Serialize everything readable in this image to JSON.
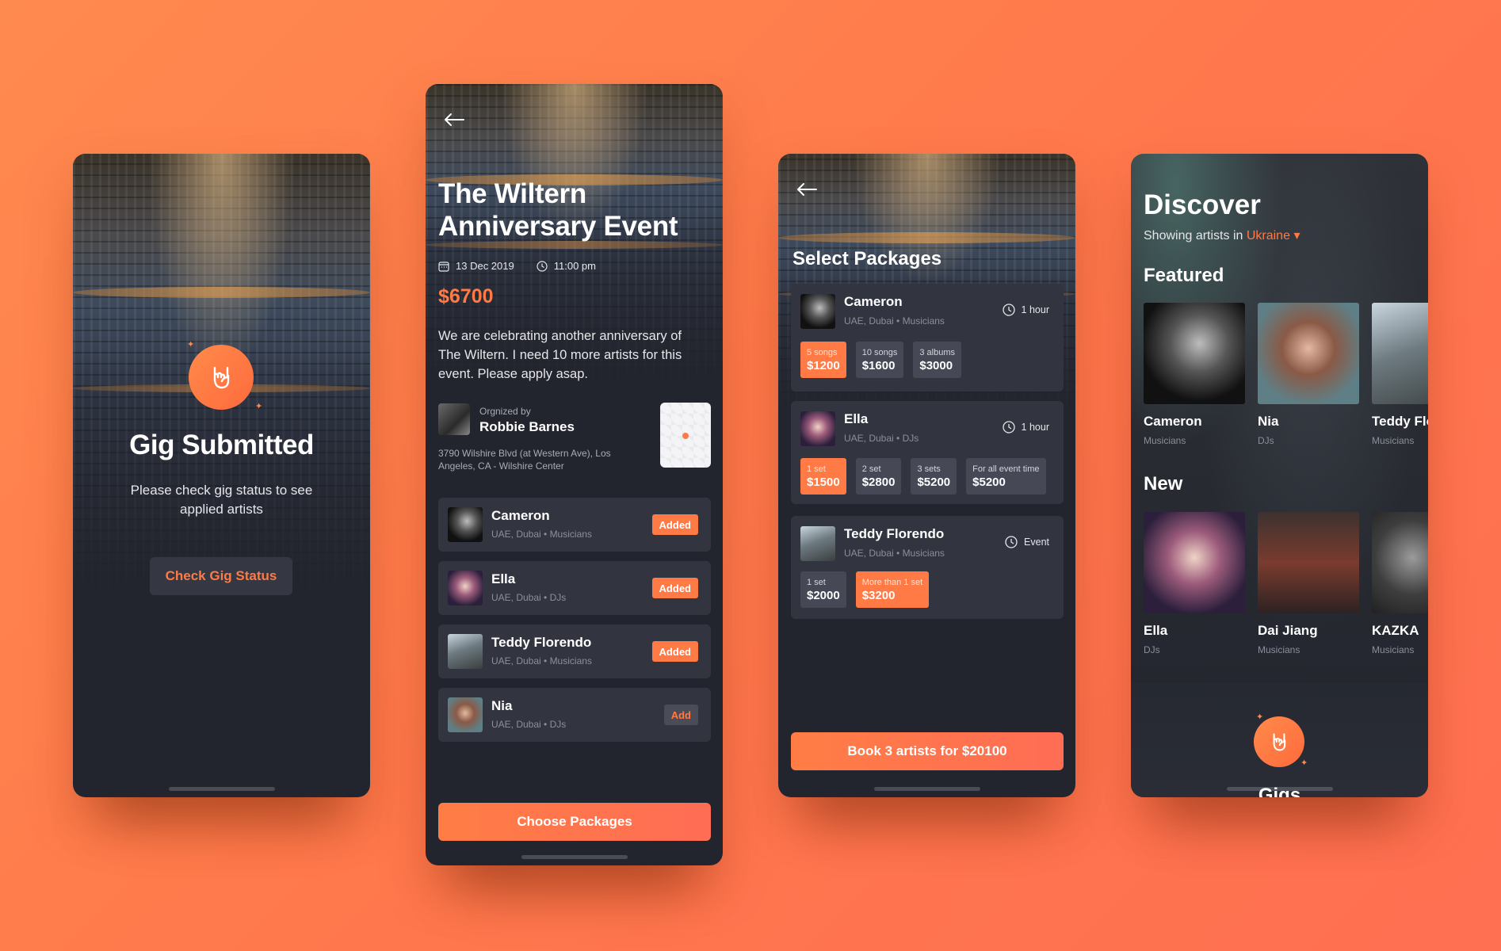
{
  "colors": {
    "accent": "#ff7a45",
    "card": "#32343f",
    "screen": "#23252e"
  },
  "gig_submitted": {
    "title": "Gig Submitted",
    "description": "Please check gig status to see applied artists",
    "check_button": "Check Gig Status"
  },
  "event": {
    "title": "The Wiltern Anniversary Event",
    "date": "13 Dec 2019",
    "time": "11:00 pm",
    "price": "$6700",
    "description": "We are celebrating another anniversary of The Wiltern. I need 10 more artists for this event. Please apply asap.",
    "organizer_label": "Orgnized by",
    "organizer_name": "Robbie Barnes",
    "address": "3790 Wilshire Blvd (at Western Ave), Los Angeles, CA - Wilshire Center",
    "artists": [
      {
        "name": "Cameron",
        "sub": "UAE, Dubai • Musicians",
        "action": "Added"
      },
      {
        "name": "Ella",
        "sub": "UAE, Dubai • DJs",
        "action": "Added"
      },
      {
        "name": "Teddy Florendo",
        "sub": "UAE, Dubai • Musicians",
        "action": "Added"
      },
      {
        "name": "Nia",
        "sub": "UAE, Dubai • DJs",
        "action": "Add"
      }
    ],
    "choose_button": "Choose Packages"
  },
  "packages": {
    "title": "Select Packages",
    "cards": [
      {
        "name": "Cameron",
        "sub": "UAE, Dubai • Musicians",
        "duration": "1 hour",
        "options": [
          {
            "label": "5 songs",
            "price": "$1200",
            "selected": true
          },
          {
            "label": "10 songs",
            "price": "$1600",
            "selected": false
          },
          {
            "label": "3 albums",
            "price": "$3000",
            "selected": false
          }
        ]
      },
      {
        "name": "Ella",
        "sub": "UAE, Dubai • DJs",
        "duration": "1 hour",
        "options": [
          {
            "label": "1 set",
            "price": "$1500",
            "selected": true
          },
          {
            "label": "2 set",
            "price": "$2800",
            "selected": false
          },
          {
            "label": "3 sets",
            "price": "$5200",
            "selected": false
          },
          {
            "label": "For all event time",
            "price": "$5200",
            "selected": false
          }
        ]
      },
      {
        "name": "Teddy Florendo",
        "sub": "UAE, Dubai • Musicians",
        "duration": "Event",
        "options": [
          {
            "label": "1 set",
            "price": "$2000",
            "selected": false
          },
          {
            "label": "More than 1 set",
            "price": "$3200",
            "selected": true
          }
        ]
      }
    ],
    "book_button": "Book 3 artists for $20100"
  },
  "discover": {
    "title": "Discover",
    "showing_prefix": "Showing artists in",
    "location": "Ukraine",
    "featured_label": "Featured",
    "featured": [
      {
        "name": "Cameron",
        "category": "Musicians"
      },
      {
        "name": "Nia",
        "category": "DJs"
      },
      {
        "name": "Teddy Florendo",
        "category": "Musicians"
      }
    ],
    "new_label": "New",
    "new": [
      {
        "name": "Ella",
        "category": "DJs"
      },
      {
        "name": "Dai Jiang",
        "category": "Musicians"
      },
      {
        "name": "KAZKA",
        "category": "Musicians"
      }
    ],
    "bottom_label": "Gigs"
  }
}
